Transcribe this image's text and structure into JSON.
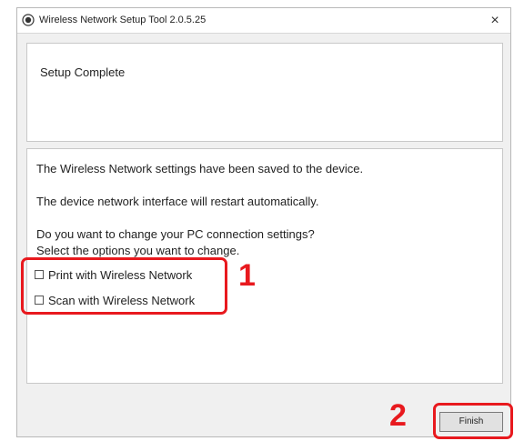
{
  "window": {
    "title": "Wireless Network Setup Tool 2.0.5.25",
    "close_glyph": "×"
  },
  "header": {
    "title": "Setup Complete"
  },
  "content": {
    "saved_message": "The Wireless Network settings have been saved to the device.",
    "restart_message": "The device network interface will restart automatically.",
    "question_line1": "Do you want to change your PC connection settings?",
    "question_line2": "Select the options you want to change.",
    "options": [
      {
        "label": "Print with Wireless Network",
        "checked": false
      },
      {
        "label": "Scan with Wireless Network",
        "checked": false
      }
    ]
  },
  "footer": {
    "finish_label": "Finish"
  },
  "annotations": {
    "step1": "1",
    "step2": "2",
    "highlight_color": "#e8191e"
  },
  "icons": {
    "app": "app-icon",
    "close": "close-icon"
  }
}
